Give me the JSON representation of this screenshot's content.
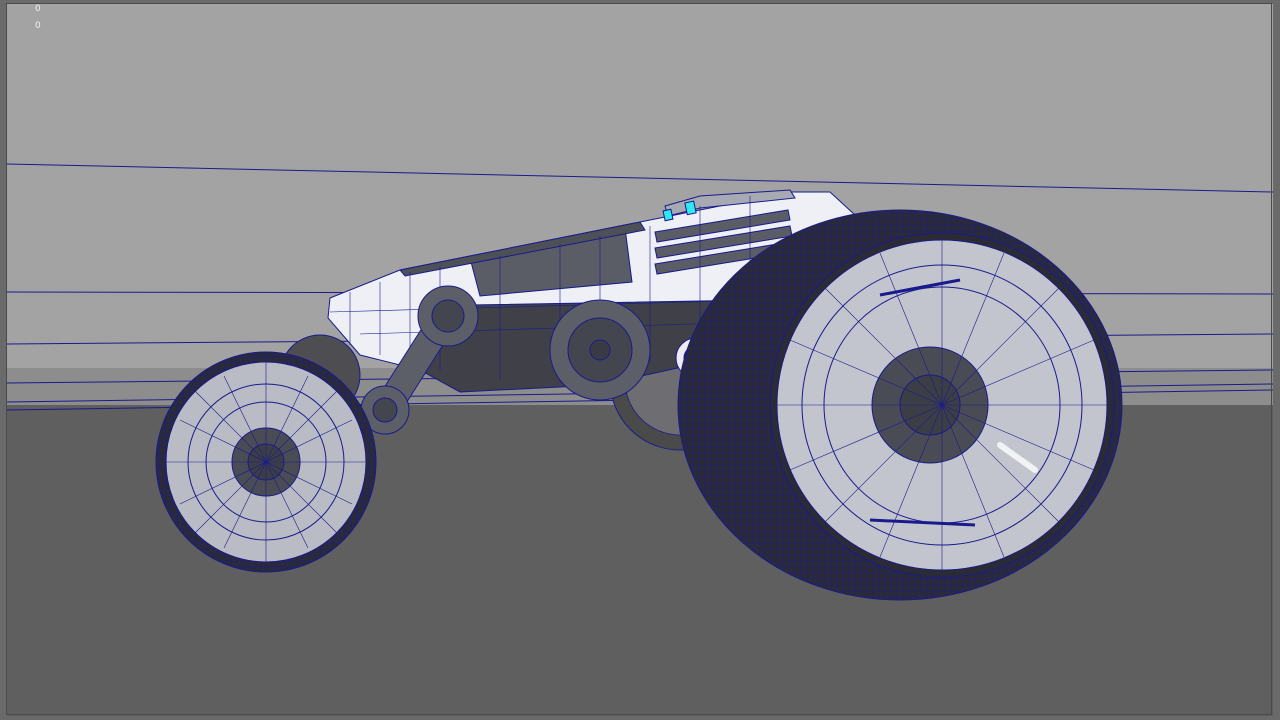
{
  "viewport": {
    "hud_values": [
      "0",
      "0"
    ]
  },
  "colors": {
    "sky": "#a3a3a3",
    "ground": "#5f5f5f",
    "wire": "#1a1a8c",
    "body": "#eef0f6",
    "panel": "#5a5c66",
    "light": "#2ee8f2"
  }
}
